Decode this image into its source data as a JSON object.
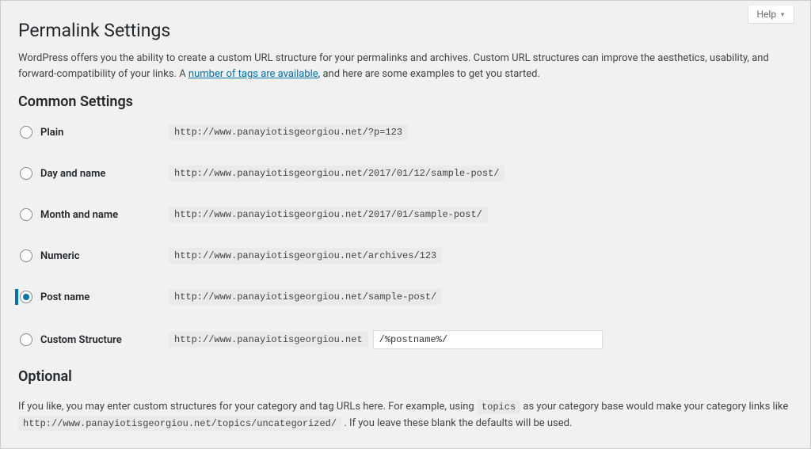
{
  "help": "Help",
  "page_title": "Permalink Settings",
  "intro_prefix": "WordPress offers you the ability to create a custom URL structure for your permalinks and archives. Custom URL structures can improve the aesthetics, usability, and forward-compatibility of your links. A ",
  "intro_link": "number of tags are available",
  "intro_suffix": ", and here are some examples to get you started.",
  "common_heading": "Common Settings",
  "options": {
    "plain": {
      "label": "Plain",
      "code": "http://www.panayiotisgeorgiou.net/?p=123"
    },
    "dayname": {
      "label": "Day and name",
      "code": "http://www.panayiotisgeorgiou.net/2017/01/12/sample-post/"
    },
    "monthname": {
      "label": "Month and name",
      "code": "http://www.panayiotisgeorgiou.net/2017/01/sample-post/"
    },
    "numeric": {
      "label": "Numeric",
      "code": "http://www.panayiotisgeorgiou.net/archives/123"
    },
    "postname": {
      "label": "Post name",
      "code": "http://www.panayiotisgeorgiou.net/sample-post/"
    },
    "custom": {
      "label": "Custom Structure",
      "base": "http://www.panayiotisgeorgiou.net",
      "value": "/%postname%/"
    }
  },
  "optional_heading": "Optional",
  "optional_p1": "If you like, you may enter custom structures for your category and tag URLs here. For example, using ",
  "optional_code1": "topics",
  "optional_p2": " as your category base would make your category links like ",
  "optional_code2": "http://www.panayiotisgeorgiou.net/topics/uncategorized/",
  "optional_p3": " . If you leave these blank the defaults will be used."
}
